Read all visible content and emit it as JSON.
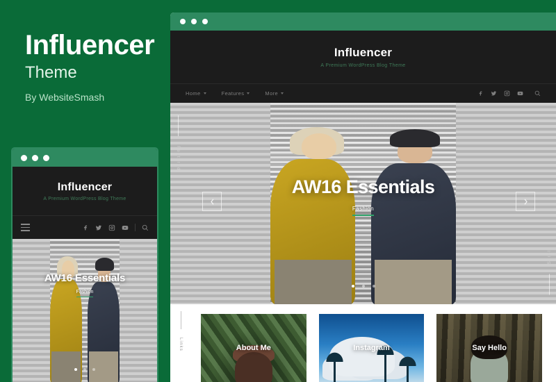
{
  "promo": {
    "title": "Influencer",
    "subtitle": "Theme",
    "author": "By WebsiteSmash"
  },
  "colors": {
    "background_green": "#0a6b38",
    "chrome_green": "#2e8a60",
    "dark_site": "#1c1c1c",
    "accent_green": "#2fa36a",
    "tagline_green": "#3f7a58"
  },
  "site": {
    "brand": "Influencer",
    "tagline": "A Premium WordPress Blog Theme",
    "menu": [
      {
        "label": "Home",
        "has_caret": true
      },
      {
        "label": "Features",
        "has_caret": true
      },
      {
        "label": "More",
        "has_caret": true
      }
    ],
    "social": [
      {
        "name": "facebook-icon"
      },
      {
        "name": "twitter-icon"
      },
      {
        "name": "instagram-icon"
      },
      {
        "name": "youtube-icon"
      }
    ],
    "search_icon": "search-icon",
    "hamburger_icon": "hamburger-menu-icon"
  },
  "hero": {
    "side_label_left": "Featured",
    "side_label_right": "Scroll",
    "title": "AW16 Essentials",
    "subtitle": "Fashion",
    "prev_label": "previous-slide",
    "next_label": "next-slide",
    "slides": 3,
    "active_slide": 1
  },
  "links_section": {
    "side_label": "Links",
    "cards": [
      {
        "label": "About Me",
        "image": "woman-in-hat-in-cornfield"
      },
      {
        "label": "Instagram",
        "image": "palm-trees-and-clouds-blue-sky"
      },
      {
        "label": "Say Hello",
        "image": "person-in-forest"
      }
    ]
  },
  "window_controls": {
    "dots": 3
  }
}
